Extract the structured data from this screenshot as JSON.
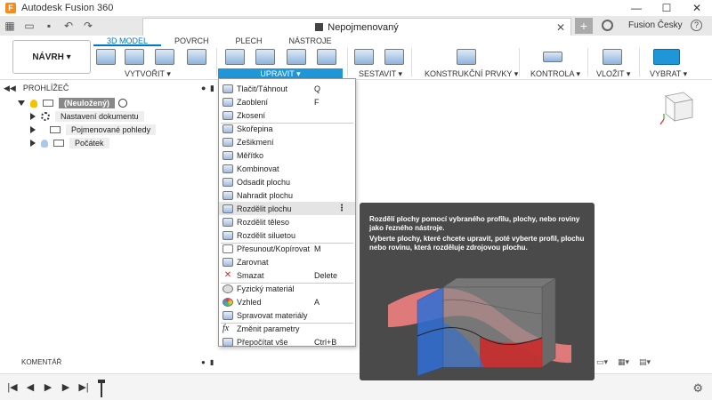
{
  "window": {
    "title": "Autodesk Fusion 360",
    "logo_letter": "F",
    "minimize": "—",
    "maximize": "☐",
    "close": "✕"
  },
  "tabbar": {
    "document_title": "Nepojmenovaný",
    "close": "✕",
    "new_tab": "+",
    "user": "Fusion Česky",
    "help": "?"
  },
  "ribbon": {
    "workspace_button": "NÁVRH ▾",
    "tabs": [
      "3D MODEL",
      "POVRCH",
      "PLECH",
      "NÁSTROJE"
    ],
    "groups": {
      "vytvorit": "VYTVOŘIT ▾",
      "upravit": "UPRAVIT ▾",
      "sestavit": "SESTAVIT ▾",
      "konstrukcni": "KONSTRUKČNÍ PRVKY ▾",
      "kontrola": "KONTROLA ▾",
      "vlozit": "VLOŽIT ▾",
      "vybrat": "VYBRAT ▾"
    }
  },
  "browser": {
    "title": "PROHLÍŽEČ",
    "root": "(Neuložený)",
    "items": [
      "Nastavení dokumentu",
      "Pojmenované pohledy",
      "Počátek"
    ]
  },
  "comments": {
    "title": "KOMENTÁŘ"
  },
  "menu": {
    "items": [
      {
        "label": "Tlačit/Táhnout",
        "shortcut": "Q"
      },
      {
        "label": "Zaoblení",
        "shortcut": "F"
      },
      {
        "label": "Zkosení",
        "shortcut": ""
      },
      {
        "label": "Skořepina",
        "shortcut": ""
      },
      {
        "label": "Zešikmení",
        "shortcut": ""
      },
      {
        "label": "Měřítko",
        "shortcut": ""
      },
      {
        "label": "Kombinovat",
        "shortcut": ""
      },
      {
        "label": "Odsadit plochu",
        "shortcut": ""
      },
      {
        "label": "Nahradit plochu",
        "shortcut": ""
      },
      {
        "label": "Rozdělit plochu",
        "shortcut": ""
      },
      {
        "label": "Rozdělit těleso",
        "shortcut": ""
      },
      {
        "label": "Rozdělit siluetou",
        "shortcut": ""
      },
      {
        "label": "Přesunout/Kopírovat",
        "shortcut": "M"
      },
      {
        "label": "Zarovnat",
        "shortcut": ""
      },
      {
        "label": "Smazat",
        "shortcut": "Delete"
      },
      {
        "label": "Fyzický materiál",
        "shortcut": ""
      },
      {
        "label": "Vzhled",
        "shortcut": "A"
      },
      {
        "label": "Spravovat materiály",
        "shortcut": ""
      },
      {
        "label": "Změnit parametry",
        "shortcut": ""
      },
      {
        "label": "Přepočítat vše",
        "shortcut": "Ctrl+B"
      }
    ],
    "more": "⋮"
  },
  "tooltip": {
    "line1": "Rozdělí plochy pomocí vybraného profilu, plochy, nebo roviny jako řezného nástroje.",
    "line2": "Vyberte plochy, které chcete upravit, poté vyberte profil, plochu nebo rovinu, která rozděluje zdrojovou plochu."
  },
  "timeline": {
    "first": "|◀",
    "prev": "◀",
    "play": "▶",
    "next": "▶",
    "last": "▶|"
  },
  "colors": {
    "accent": "#1f96d8",
    "tab_active": "#0078c8",
    "tooltip_bg": "#4a4a4a"
  }
}
